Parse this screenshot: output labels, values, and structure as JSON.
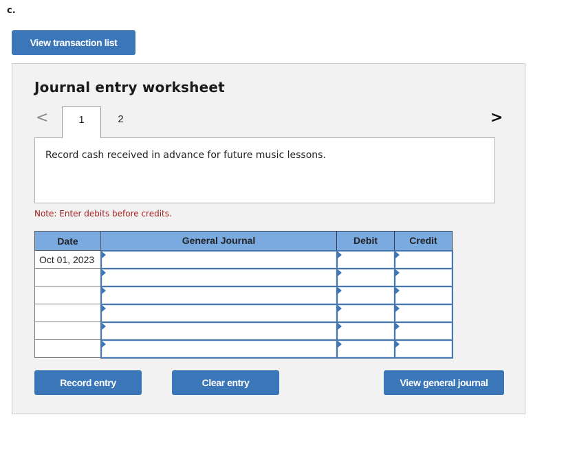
{
  "part_label": "c.",
  "view_transaction_list_label": "View transaction list",
  "worksheet": {
    "title": "Journal entry worksheet",
    "nav": {
      "prev_icon": "chevron-left-icon",
      "next_icon": "chevron-right-icon",
      "prev_glyph": "<",
      "next_glyph": ">"
    },
    "tabs": [
      {
        "label": "1",
        "active": true
      },
      {
        "label": "2",
        "active": false
      }
    ],
    "description": "Record cash received in advance for future music lessons.",
    "note": "Note: Enter debits before credits.",
    "table": {
      "headers": {
        "date": "Date",
        "general_journal": "General Journal",
        "debit": "Debit",
        "credit": "Credit"
      },
      "rows": [
        {
          "date": "Oct 01, 2023",
          "account": "",
          "debit": "",
          "credit": ""
        },
        {
          "date": "",
          "account": "",
          "debit": "",
          "credit": ""
        },
        {
          "date": "",
          "account": "",
          "debit": "",
          "credit": ""
        },
        {
          "date": "",
          "account": "",
          "debit": "",
          "credit": ""
        },
        {
          "date": "",
          "account": "",
          "debit": "",
          "credit": ""
        },
        {
          "date": "",
          "account": "",
          "debit": "",
          "credit": ""
        }
      ]
    },
    "buttons": {
      "record": "Record entry",
      "clear": "Clear entry",
      "view_general_journal": "View general journal"
    }
  },
  "colors": {
    "button_blue": "#3a76b8",
    "header_blue": "#7aaae0",
    "note_red": "#a31f1f",
    "panel_bg": "#f2f2f2"
  }
}
